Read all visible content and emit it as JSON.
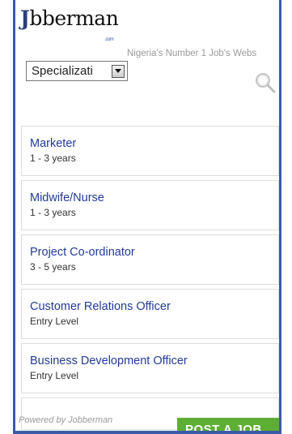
{
  "header": {
    "logo_initial": "J",
    "logo_rest": "bberman",
    "logo_suffix": ".com",
    "tagline": "Nigeria's Number 1 Job's Webs"
  },
  "filter": {
    "selected": "Specializati"
  },
  "search": {
    "icon": "search-icon"
  },
  "jobs": [
    {
      "title": "Marketer",
      "experience": "1 - 3 years"
    },
    {
      "title": "Midwife/Nurse",
      "experience": "1 - 3 years"
    },
    {
      "title": "Project Co-ordinator",
      "experience": "3 - 5 years"
    },
    {
      "title": "Customer Relations Officer",
      "experience": "Entry Level"
    },
    {
      "title": "Business Development Officer",
      "experience": "Entry Level"
    }
  ],
  "footer": {
    "powered_by": "Powered by Jobberman",
    "post_job": "POST A JOB"
  },
  "colors": {
    "frame": "#3b5ba8",
    "link": "#233a99",
    "post_button": "#5eae34"
  }
}
